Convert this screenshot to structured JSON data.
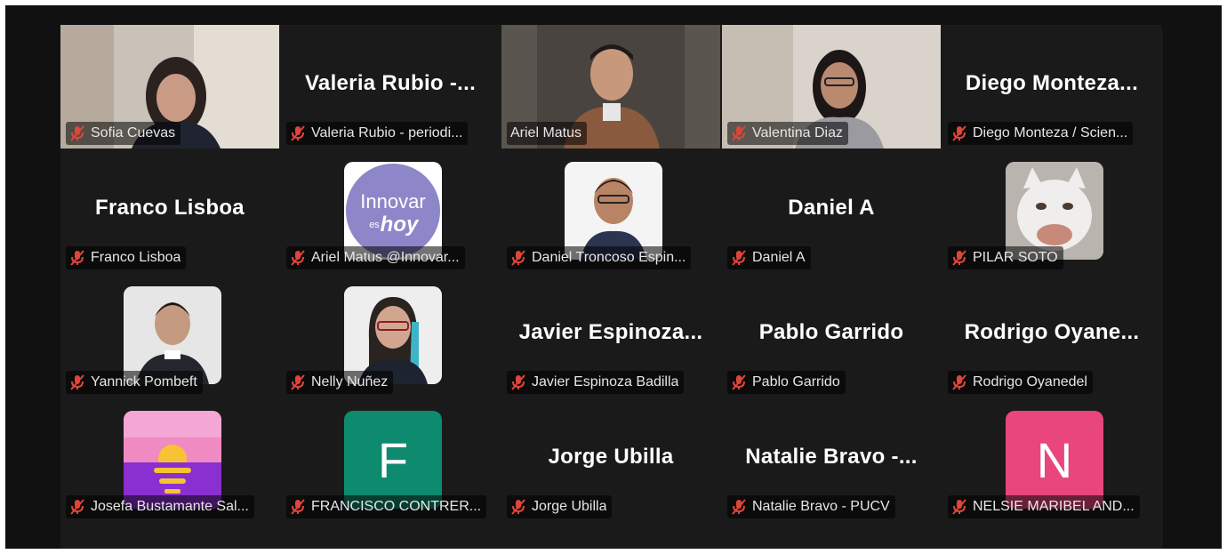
{
  "participants": [
    {
      "label": "Sofia Cuevas"
    },
    {
      "display": "Valeria  Rubio  -...",
      "label": "Valeria Rubio - periodi..."
    },
    {
      "label": "Ariel Matus"
    },
    {
      "label": "Valentina Diaz"
    },
    {
      "display": "Diego  Monteza...",
      "label": "Diego Monteza / Scien..."
    },
    {
      "display": "Franco Lisboa",
      "label": "Franco Lisboa"
    },
    {
      "label": "Ariel  Matus @Innovar...",
      "avatar_text_top": "Innovar",
      "avatar_text_bottom": "hoy",
      "avatar_text_small": "es"
    },
    {
      "label": "Daniel Troncoso Espin..."
    },
    {
      "display": "Daniel A",
      "label": "Daniel A"
    },
    {
      "label": "PILAR SOTO"
    },
    {
      "label": "Yannick Pombeft"
    },
    {
      "label": "Nelly Nuñez"
    },
    {
      "display": "Javier  Espinoza...",
      "label": "Javier Espinoza Badilla"
    },
    {
      "display": "Pablo Garrido",
      "label": "Pablo Garrido"
    },
    {
      "display": "Rodrigo  Oyane...",
      "label": "Rodrigo Oyanedel"
    },
    {
      "label": "Josefa Bustamante Sal..."
    },
    {
      "label": "FRANCISCO CONTRER...",
      "avatar_letter": "F"
    },
    {
      "display": "Jorge Ubilla",
      "label": "Jorge Ubilla"
    },
    {
      "display": "Natalie  Bravo  -...",
      "label": "Natalie Bravo - PUCV"
    },
    {
      "label": "NELSIE MARIBEL AND...",
      "avatar_letter": "N"
    }
  ],
  "colors": {
    "active_speaker_border": "#23d959",
    "muted_mic": "#e0453a",
    "avatar_f_bg": "#0e8a6e",
    "avatar_n_bg": "#e8467c",
    "innovar_bg": "#8d86c9"
  }
}
